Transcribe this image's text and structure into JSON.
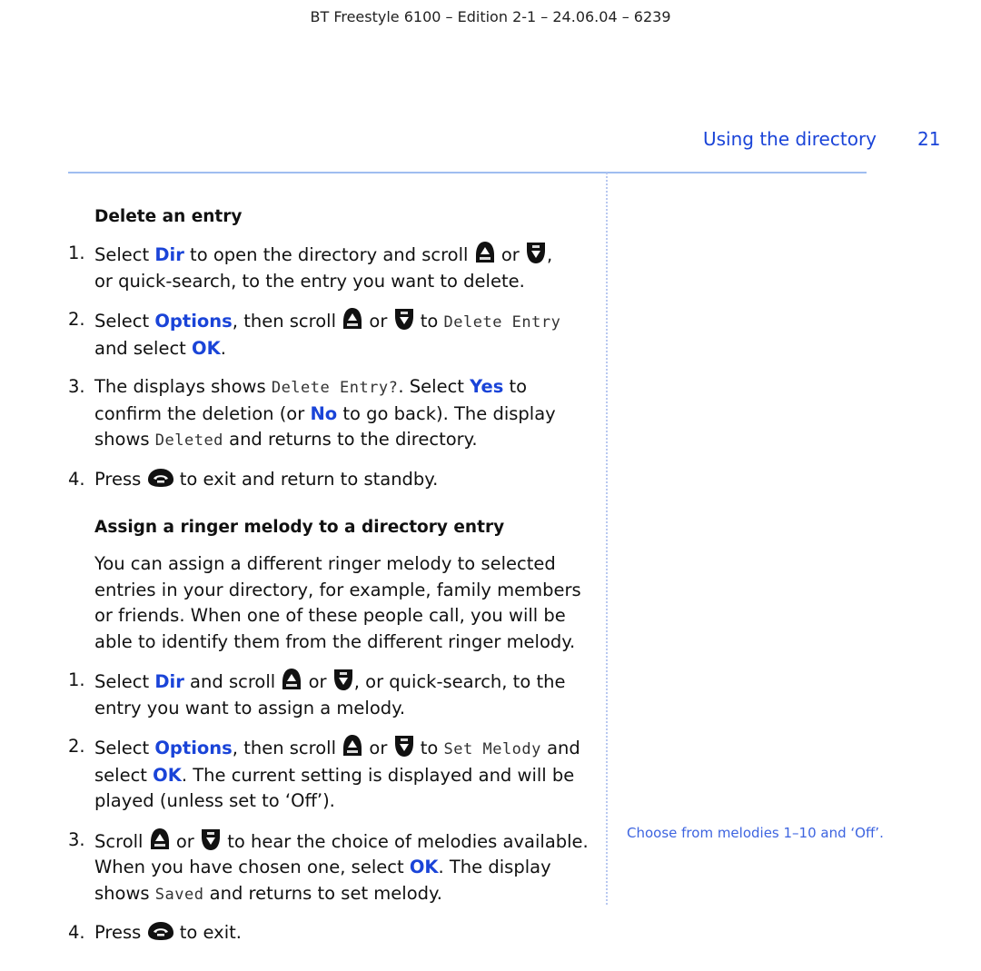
{
  "header": {
    "doc_title": "BT Freestyle 6100 – Edition 2-1 – 24.06.04 – 6239",
    "section_title": "Using the directory",
    "page_number": "21"
  },
  "colors": {
    "accent": "#1a44d8",
    "rule": "#9fbdf0",
    "sidenote": "#3d64e0"
  },
  "icons": {
    "up": "redial-up-arrow-key-icon",
    "down": "calls-down-arrow-key-icon",
    "end": "end-call-handset-icon"
  },
  "delete_section": {
    "heading": "Delete an entry",
    "steps": [
      {
        "num": "1.",
        "a": "Select ",
        "k1": "Dir",
        "b": " to open the directory and scroll ",
        "c": " or ",
        "d": ",",
        "e": "or quick-search, to the entry you want to delete."
      },
      {
        "num": "2.",
        "a": "Select ",
        "k1": "Options",
        "b": ", then scroll ",
        "c": " or ",
        "d": " to ",
        "lcd": "Delete Entry",
        "e": "and select ",
        "k2": "OK",
        "f": "."
      },
      {
        "num": "3.",
        "a": "The displays shows ",
        "lcd1": "Delete Entry?",
        "b": ". Select ",
        "k1": "Yes",
        "c": " to confirm the deletion (or ",
        "k2": "No",
        "d": " to go back). The display shows ",
        "lcd2": "Deleted",
        "e": " and returns to the directory."
      },
      {
        "num": "4.",
        "a": "Press ",
        "b": " to exit and return to standby."
      }
    ]
  },
  "melody_section": {
    "heading": "Assign a ringer melody to a directory entry",
    "intro": "You can assign a different ringer melody to selected entries in your directory, for example, family members or friends. When one of these people call, you will be able to identify them from the different ringer melody.",
    "steps": [
      {
        "num": "1.",
        "a": "Select ",
        "k1": "Dir",
        "b": " and scroll ",
        "c": " or ",
        "d": ", or quick-search, to the entry you want to assign a melody."
      },
      {
        "num": "2.",
        "a": "Select ",
        "k1": "Options",
        "b": ", then scroll ",
        "c": " or ",
        "d": " to ",
        "lcd": "Set Melody",
        "e": " and select ",
        "k2": "OK",
        "f": ". The current setting is displayed and will be played (unless set to ‘Off’)."
      },
      {
        "num": "3.",
        "a": "Scroll ",
        "b": " or ",
        "c": " to hear the choice of melodies available. When you have chosen one, select ",
        "k1": "OK",
        "d": ". The display shows ",
        "lcd": "Saved",
        "e": " and returns to set melody."
      },
      {
        "num": "4.",
        "a": "Press ",
        "b": " to exit."
      }
    ]
  },
  "sidenote": "Choose from melodies 1–10 and ‘Off’."
}
